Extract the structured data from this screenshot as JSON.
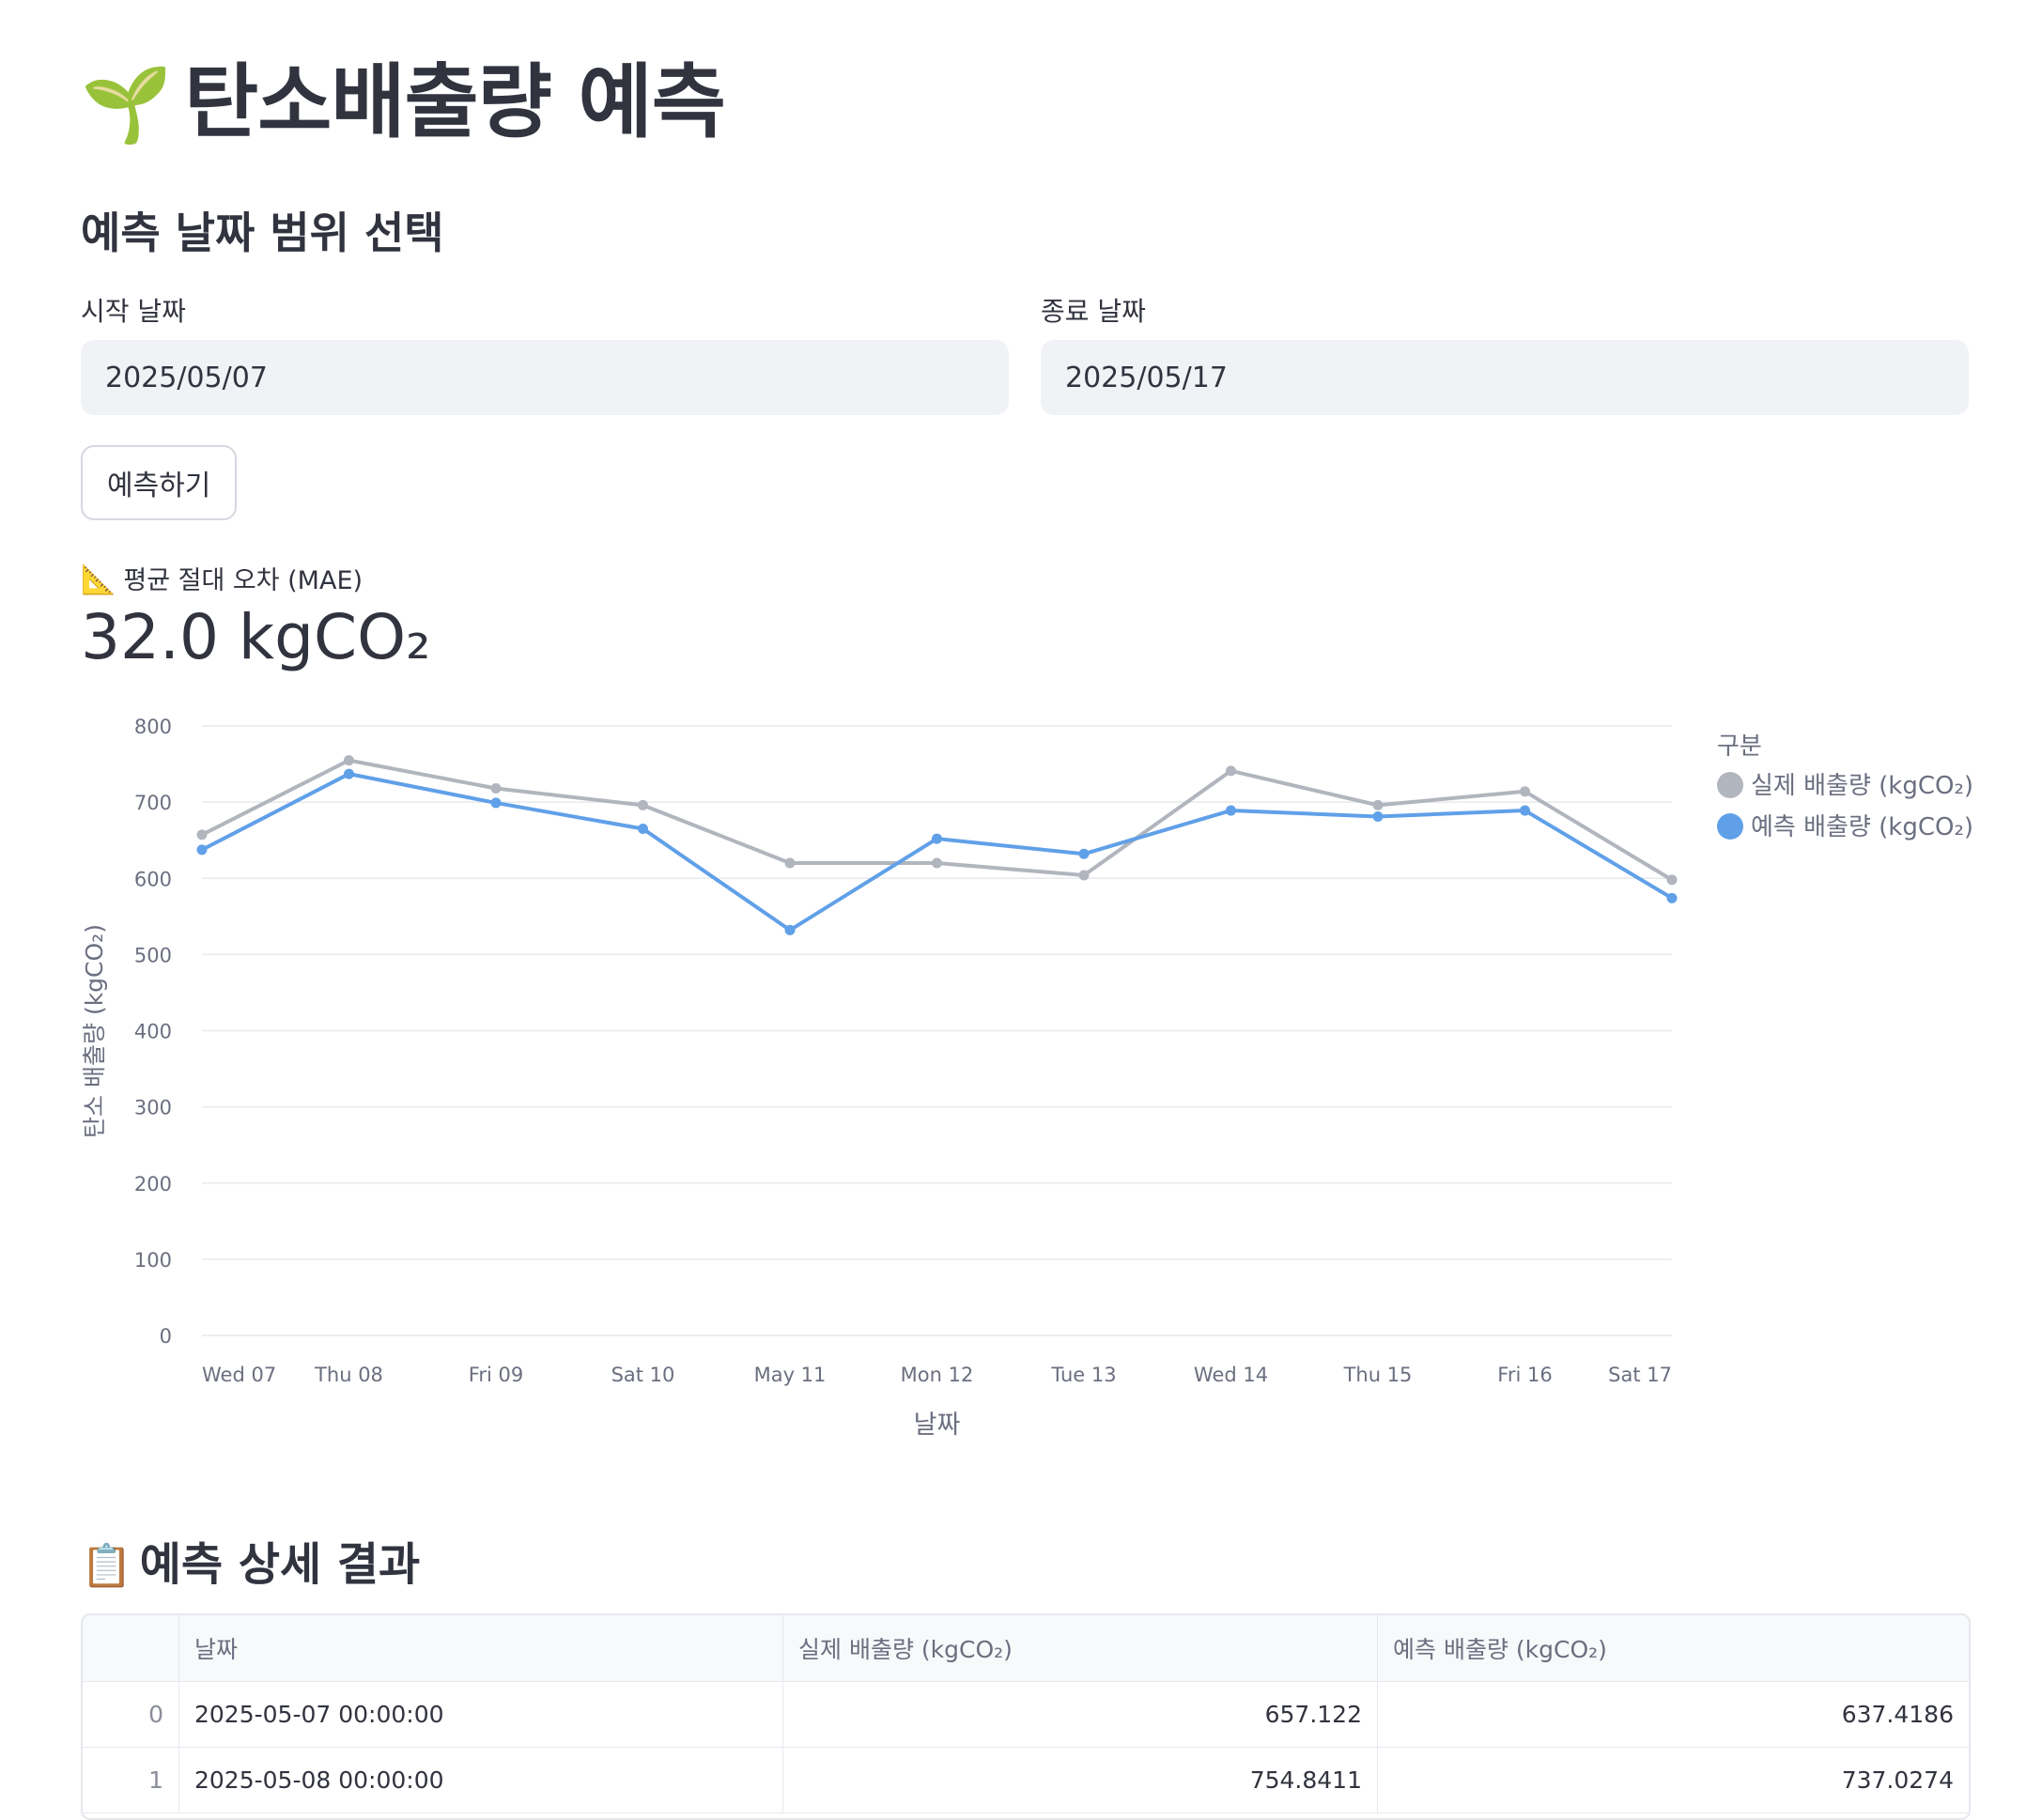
{
  "page": {
    "title": "탄소배출량 예측",
    "title_icon": "seedling-icon",
    "subtitle": "예측 날짜 범위 선택"
  },
  "date_range": {
    "start_label": "시작 날짜",
    "start_value": "2025/05/07",
    "end_label": "종료 날짜",
    "end_value": "2025/05/17"
  },
  "predict_button": "예측하기",
  "metric": {
    "icon": "triangular-ruler-icon",
    "label": "평균 절대 오차 (MAE)",
    "value": "32.0 kgCO₂"
  },
  "chart_data": {
    "type": "line",
    "x": [
      "Wed 07",
      "Thu 08",
      "Fri 09",
      "Sat 10",
      "May 11",
      "Mon 12",
      "Tue 13",
      "Wed 14",
      "Thu 15",
      "Fri 16",
      "Sat 17"
    ],
    "xlabel": "날짜",
    "ylabel": "탄소 배출량 (kgCO₂)",
    "ylim": [
      0,
      800
    ],
    "yticks": [
      0,
      100,
      200,
      300,
      400,
      500,
      600,
      700,
      800
    ],
    "grid": true,
    "legend_title": "구분",
    "legend_position": "right",
    "series": [
      {
        "name": "실제 배출량 (kgCO₂)",
        "color": "#b1b5bd",
        "values": [
          657.122,
          754.8411,
          718,
          696,
          620,
          620,
          604,
          741,
          696,
          714,
          598
        ]
      },
      {
        "name": "예측 배출량 (kgCO₂)",
        "color": "#60a0e8",
        "values": [
          637.4186,
          737.0274,
          699,
          665,
          532,
          652,
          632,
          689,
          681,
          689,
          574
        ]
      }
    ]
  },
  "detail_section": {
    "icon": "clipboard-icon",
    "title": "예측 상세 결과",
    "columns": [
      "",
      "날짜",
      "실제 배출량 (kgCO₂)",
      "예측 배출량 (kgCO₂)"
    ],
    "rows": [
      [
        "0",
        "2025-05-07 00:00:00",
        "657.122",
        "637.4186"
      ],
      [
        "1",
        "2025-05-08 00:00:00",
        "754.8411",
        "737.0274"
      ]
    ]
  }
}
